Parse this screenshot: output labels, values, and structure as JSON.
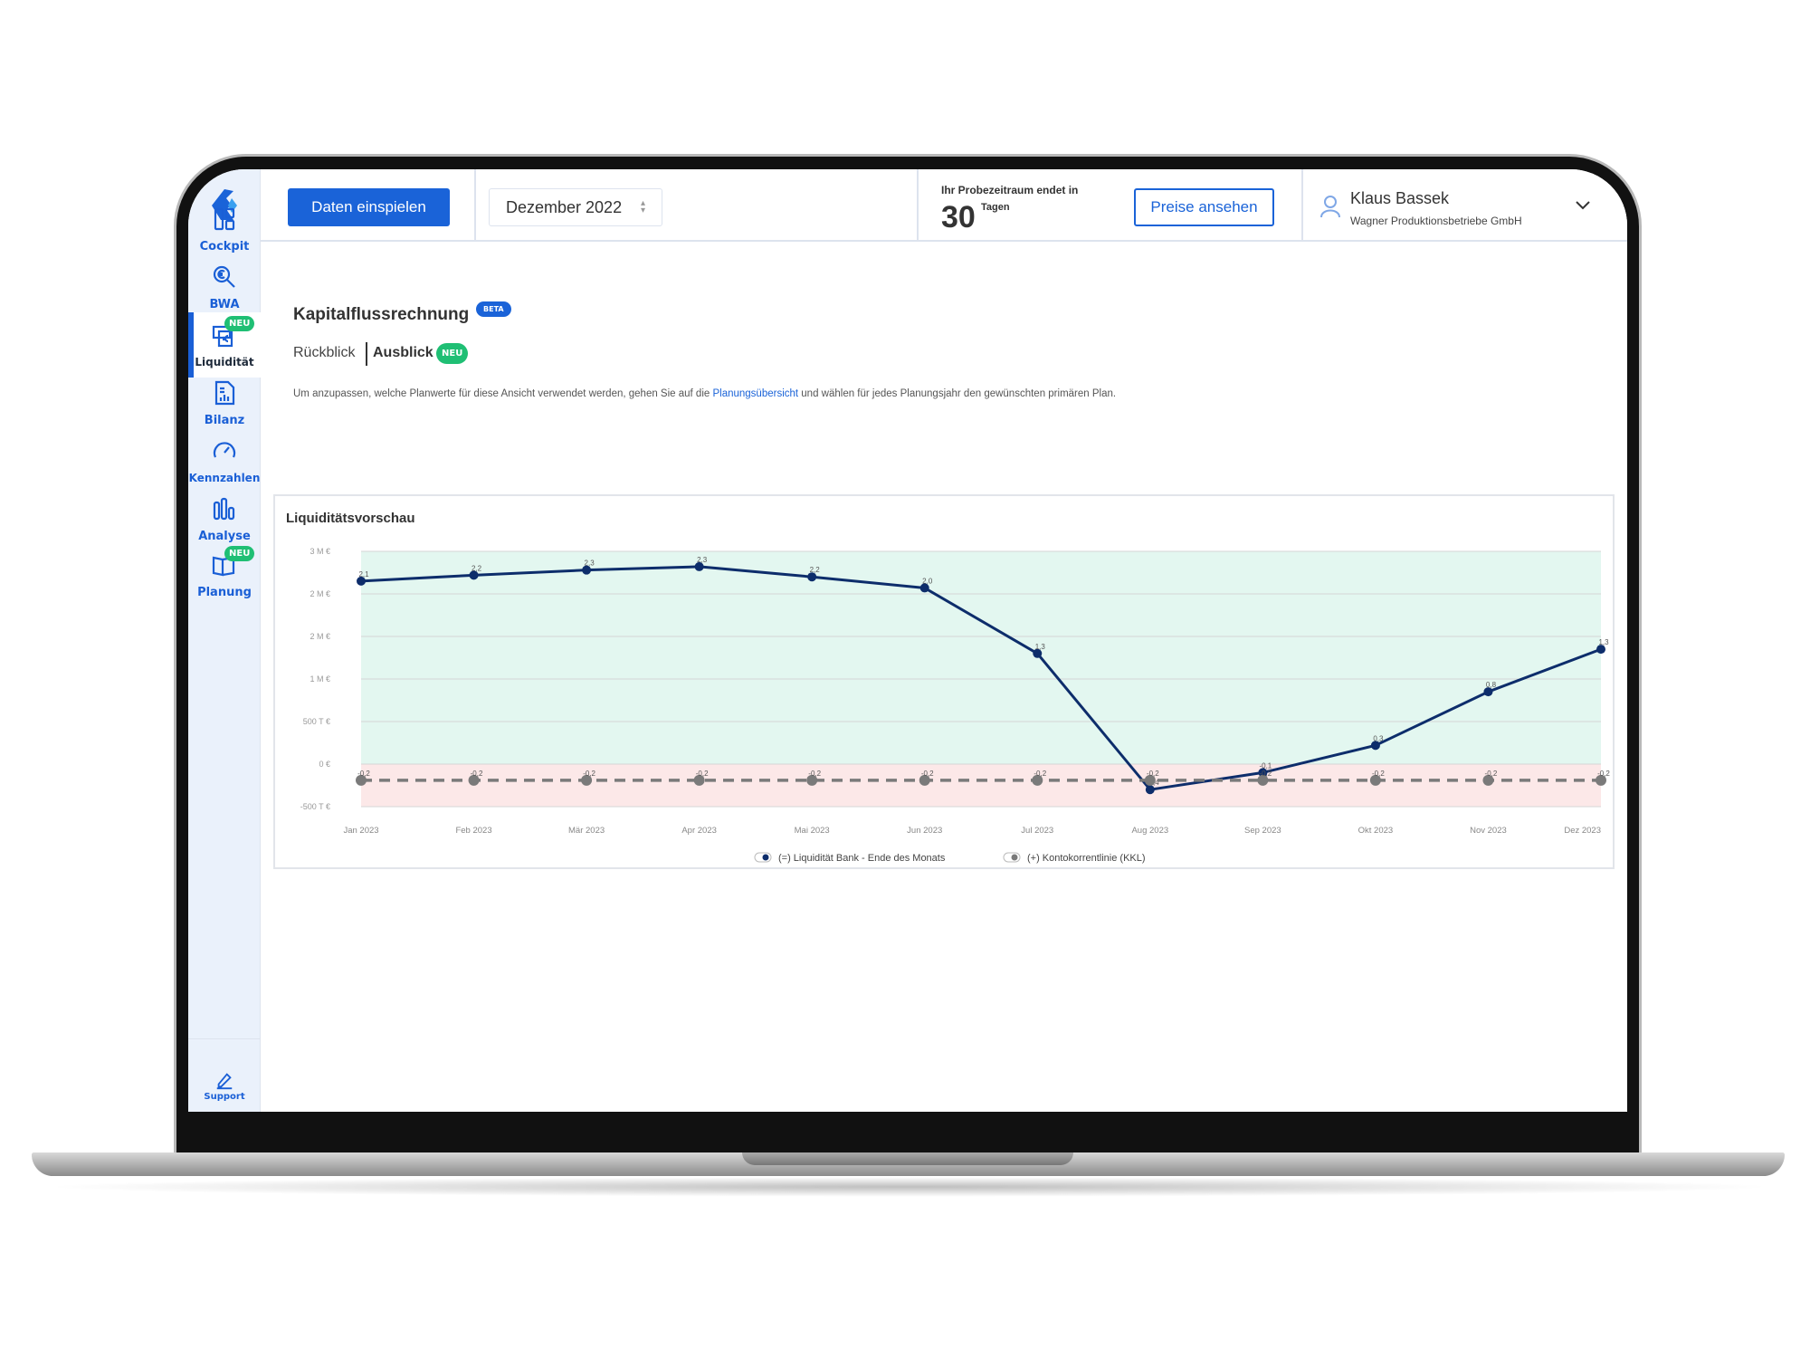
{
  "sidebar": {
    "items": [
      {
        "label": "Cockpit",
        "icon": "dashboard-icon"
      },
      {
        "label": "BWA",
        "icon": "search-euro-icon"
      },
      {
        "label": "Liquidität",
        "icon": "cash-icon",
        "badge": "NEU",
        "active": true
      },
      {
        "label": "Bilanz",
        "icon": "report-icon"
      },
      {
        "label": "Kennzahlen",
        "icon": "speedometer-icon"
      },
      {
        "label": "Analyse",
        "icon": "bar-chart-icon"
      },
      {
        "label": "Planung",
        "icon": "book-icon",
        "badge": "NEU"
      }
    ],
    "support_label": "Support"
  },
  "header": {
    "import_button": "Daten einspielen",
    "period_select": "Dezember 2022",
    "trial_text": "Ihr Probezeitraum endet in",
    "trial_days": "30",
    "trial_unit": "Tagen",
    "pricing_button": "Preise ansehen",
    "user_name": "Klaus Bassek",
    "company": "Wagner Produktionsbetriebe GmbH"
  },
  "page": {
    "title": "Kapitalflussrechnung",
    "title_badge": "BETA",
    "tabs": [
      {
        "label": "Rückblick",
        "active": false
      },
      {
        "label": "Ausblick",
        "active": true,
        "badge": "NEU"
      }
    ],
    "info_before": "Um anzupassen, welche Planwerte für diese Ansicht verwendet werden, gehen Sie auf die ",
    "info_link": "Planungsübersicht",
    "info_after": " und wählen für jedes Planungsjahr den gewünschten primären Plan."
  },
  "colors": {
    "accent": "#1a63d8",
    "positive_zone": "#e3f7f0",
    "negative_zone": "#fce8e8",
    "series_main": "#0d2d6b",
    "series_kkl": "#7a7a7a",
    "badge_green": "#1fbf74"
  },
  "chart_data": {
    "type": "line",
    "title": "Liquiditätsvorschau",
    "categories": [
      "Jan 2023",
      "Feb 2023",
      "Mär 2023",
      "Apr 2023",
      "Mai 2023",
      "Jun 2023",
      "Jul 2023",
      "Aug 2023",
      "Sep 2023",
      "Okt 2023",
      "Nov 2023",
      "Dez 2023"
    ],
    "ylim": [
      -0.5,
      2.5
    ],
    "y_unit": "M €",
    "y_ticks": [
      {
        "value": 2.5,
        "label": "3 M €"
      },
      {
        "value": 2.0,
        "label": "2 M €"
      },
      {
        "value": 1.5,
        "label": "2 M €"
      },
      {
        "value": 1.0,
        "label": "1 M €"
      },
      {
        "value": 0.5,
        "label": "500 T €"
      },
      {
        "value": 0,
        "label": "0 €"
      },
      {
        "value": -0.5,
        "label": "-500 T €"
      }
    ],
    "grid": true,
    "legend_position": "bottom",
    "series": [
      {
        "name": "(=) Liquidität Bank - Ende des Monats",
        "style": "solid",
        "values": [
          2.15,
          2.22,
          2.28,
          2.32,
          2.2,
          2.07,
          1.3,
          -0.3,
          -0.1,
          0.22,
          0.85,
          1.35
        ],
        "labels": [
          "2,1",
          "2,2",
          "2,3",
          "2,3",
          "2,2",
          "2,0",
          "1,3",
          "-0,4",
          "-0,1",
          "0,3",
          "0,8",
          "1,3"
        ]
      },
      {
        "name": "(+) Kontokorrentlinie (KKL)",
        "style": "dashed",
        "values": [
          -0.19,
          -0.19,
          -0.19,
          -0.19,
          -0.19,
          -0.19,
          -0.19,
          -0.19,
          -0.19,
          -0.19,
          -0.19,
          -0.19
        ],
        "labels": [
          "-0,2",
          "-0,2",
          "-0,2",
          "-0,2",
          "-0,2",
          "-0,2",
          "-0,2",
          "-0,2",
          "-0,2",
          "-0,2",
          "-0,2",
          "-0,2"
        ]
      }
    ]
  }
}
